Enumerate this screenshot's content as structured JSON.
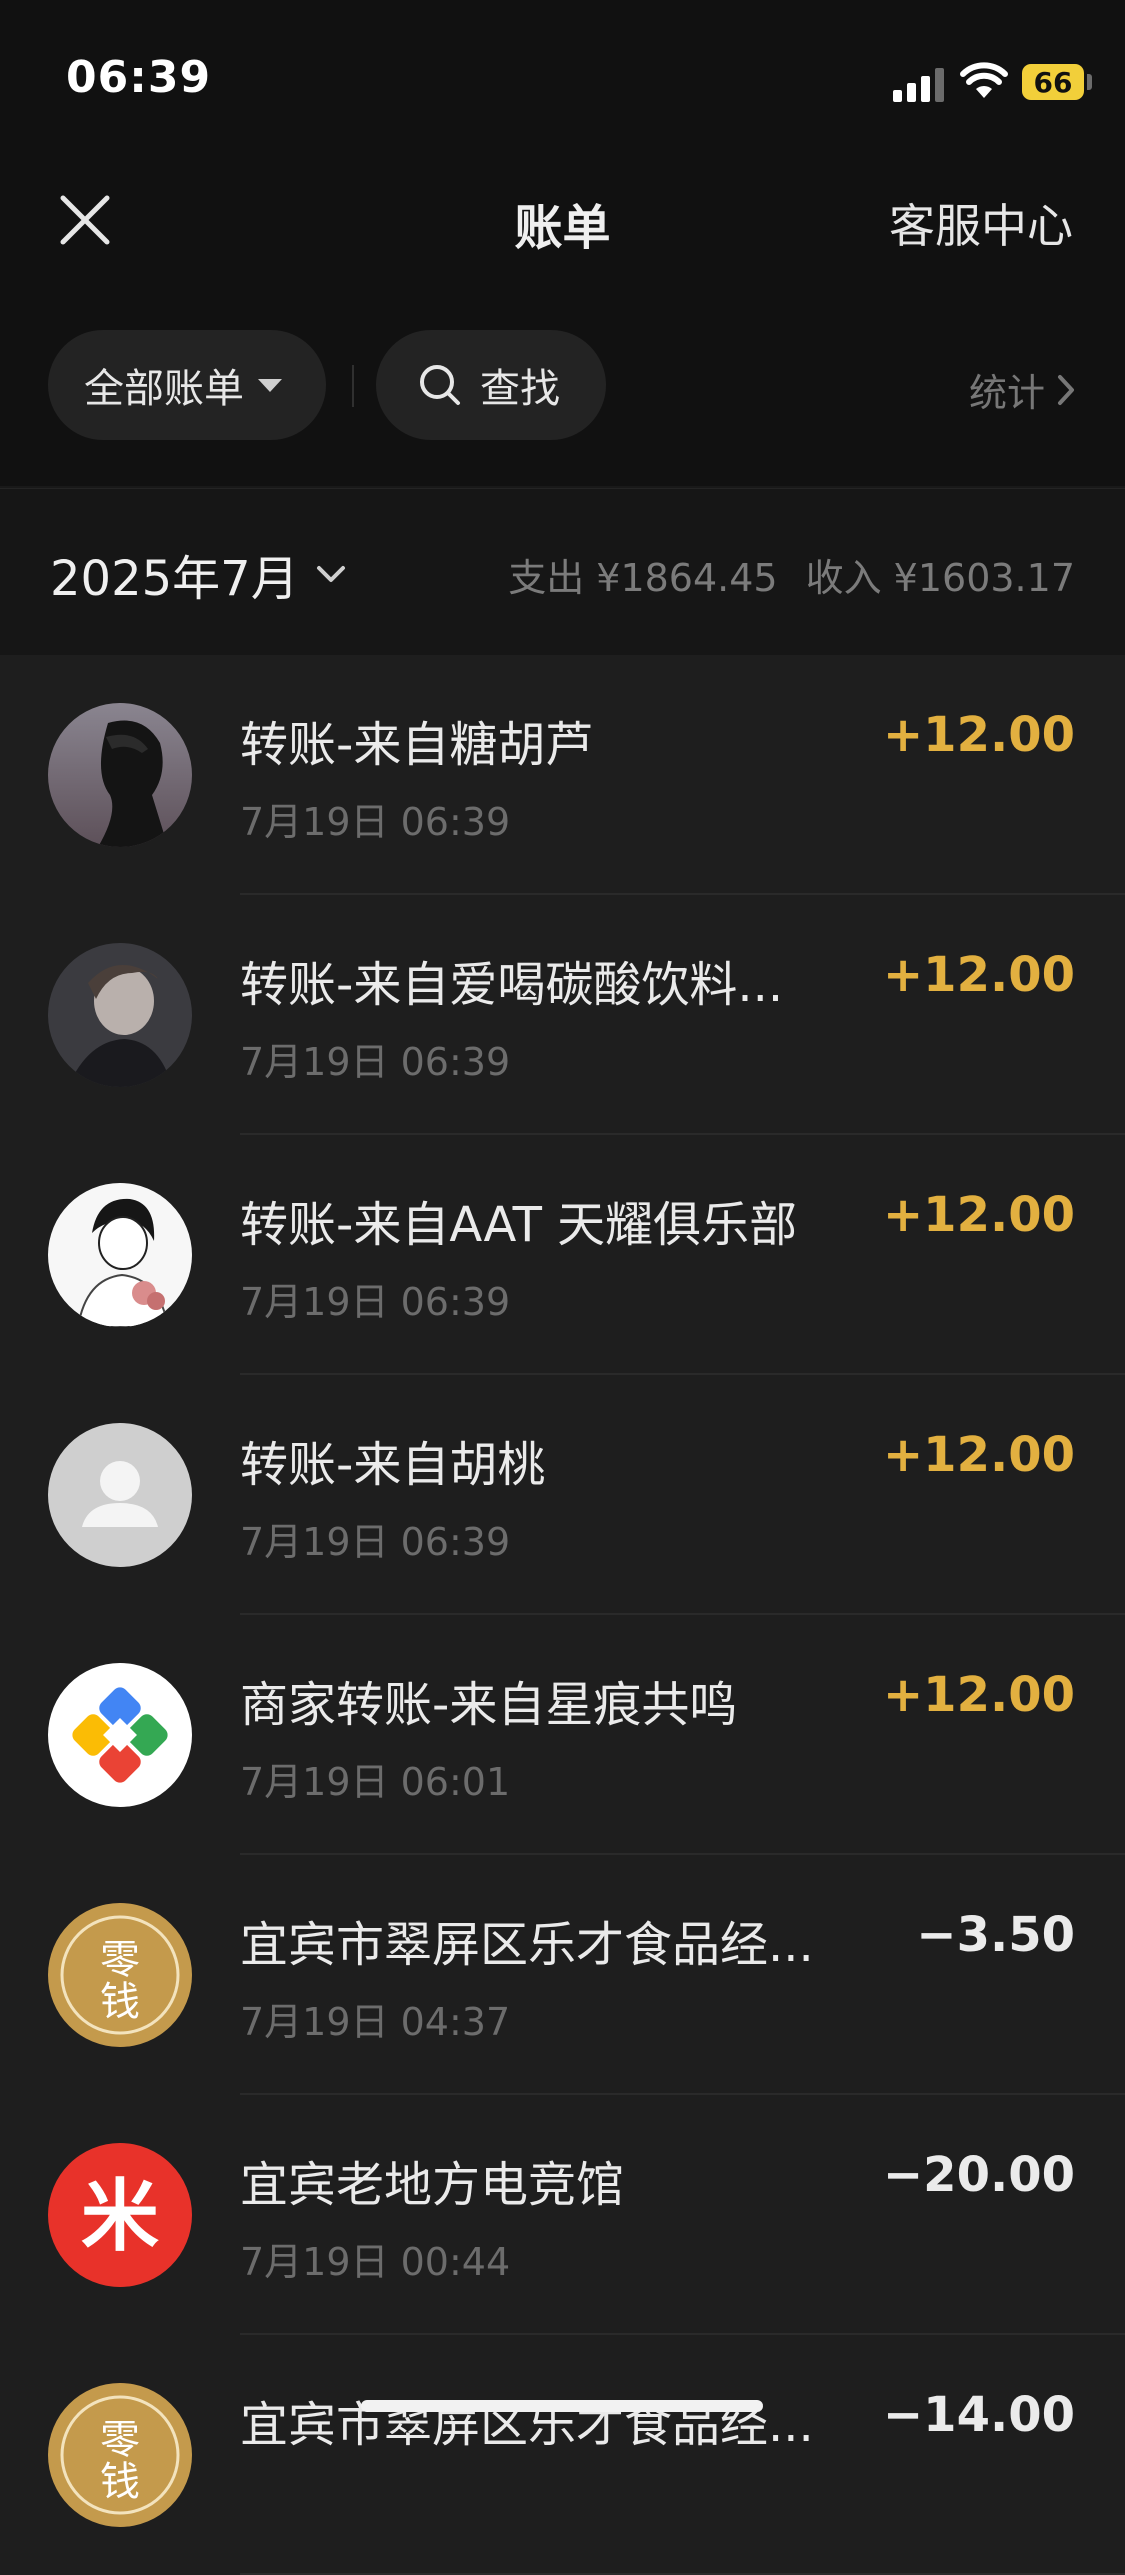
{
  "status": {
    "time": "06:39",
    "battery": "66"
  },
  "header": {
    "title": "账单",
    "service_label": "客服中心"
  },
  "filters": {
    "all_label": "全部账单",
    "search_label": "查找",
    "stats_label": "统计"
  },
  "month_header": {
    "month": "2025年7月",
    "expense": "支出 ¥1864.45",
    "income": "收入 ¥1603.17"
  },
  "transactions": [
    {
      "title": "转账-来自糖胡芦",
      "date": "7月19日 06:39",
      "amount": "+12.00",
      "type": "income"
    },
    {
      "title": "转账-来自爱喝碳酸饮料...",
      "date": "7月19日 06:39",
      "amount": "+12.00",
      "type": "income"
    },
    {
      "title": "转账-来自AAT 天耀俱乐部",
      "date": "7月19日 06:39",
      "amount": "+12.00",
      "type": "income"
    },
    {
      "title": "转账-来自胡桃",
      "date": "7月19日 06:39",
      "amount": "+12.00",
      "type": "income"
    },
    {
      "title": "商家转账-来自星痕共鸣",
      "date": "7月19日 06:01",
      "amount": "+12.00",
      "type": "income"
    },
    {
      "title": "宜宾市翠屏区乐才食品经...",
      "date": "7月19日 04:37",
      "amount": "−3.50",
      "type": "expense"
    },
    {
      "title": "宜宾老地方电竞馆",
      "date": "7月19日 00:44",
      "amount": "−20.00",
      "type": "expense"
    },
    {
      "title": "宜宾市翠屏区乐才食品经...",
      "date": "",
      "amount": "−14.00",
      "type": "expense"
    }
  ],
  "avatar_labels": {
    "wallet_top": "零",
    "wallet_bottom": "钱",
    "mi_logo": "米"
  },
  "colors": {
    "income": "#e2b040",
    "background": "#191919",
    "wallet_gold": "#c49a4c",
    "mi_red": "#e8322a"
  }
}
